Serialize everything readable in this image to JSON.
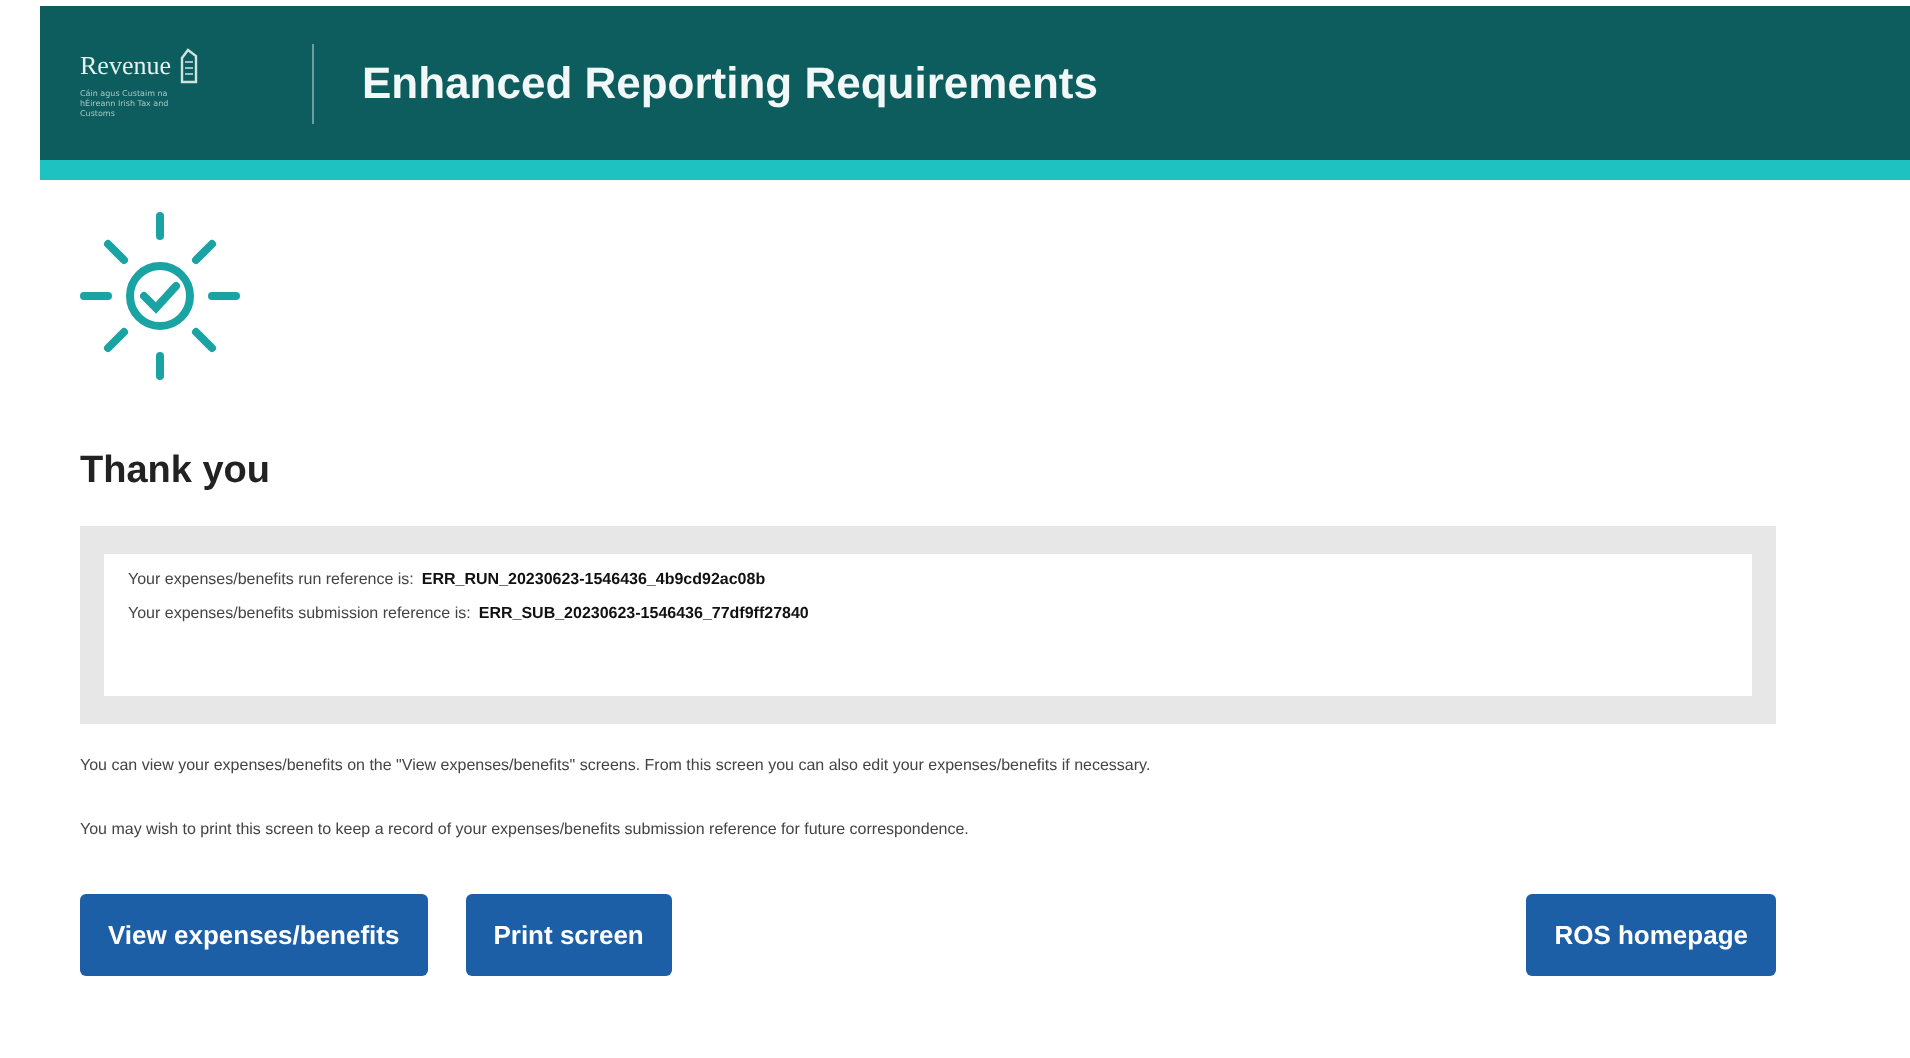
{
  "header": {
    "logo_text": "Revenue",
    "logo_tagline": "Cáin agus Custaim na hÉireann Irish Tax and Customs",
    "title": "Enhanced Reporting Requirements"
  },
  "heading": "Thank you",
  "references": [
    {
      "label": "Your expenses/benefits run reference is:",
      "value": "ERR_RUN_20230623-1546436_4b9cd92ac08b"
    },
    {
      "label": "Your expenses/benefits submission reference is:",
      "value": "ERR_SUB_20230623-1546436_77df9ff27840"
    }
  ],
  "paragraphs": [
    "You can view your expenses/benefits on the \"View expenses/benefits\" screens. From this screen you can also edit your expenses/benefits if necessary.",
    "You may wish to print this screen to keep a record of your expenses/benefits submission reference for future correspondence."
  ],
  "buttons_left": [
    "View expenses/benefits",
    "Print screen"
  ],
  "buttons_right": [
    "ROS homepage"
  ]
}
